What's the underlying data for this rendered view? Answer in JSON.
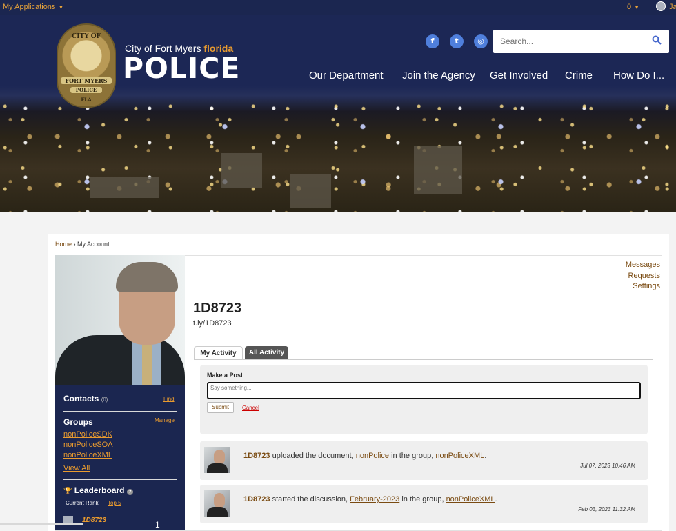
{
  "topbar": {
    "apps_label": "My Applications",
    "notif_count": "0",
    "user_initial": "Ja"
  },
  "brand": {
    "city": "City of Fort Myers",
    "state": "florida",
    "title": "POLICE",
    "badge": {
      "top": "CITY OF",
      "mid": "FORT MYERS",
      "police": "POLICE",
      "state": "FLA"
    }
  },
  "social": [
    {
      "icon": "facebook-icon",
      "glyph": "f"
    },
    {
      "icon": "twitter-icon",
      "glyph": "t"
    },
    {
      "icon": "instagram-icon",
      "glyph": "◎"
    }
  ],
  "search": {
    "placeholder": "Search...",
    "icon": "search-icon"
  },
  "nav": [
    "Our Department",
    "Join the Agency",
    "Get Involved",
    "Crime",
    "How Do I..."
  ],
  "breadcrumb": {
    "home": "Home",
    "sep": "›",
    "current": "My Account"
  },
  "profile": {
    "username": "1D8723",
    "short_link": "t.ly/1D8723"
  },
  "right_links": [
    "Messages",
    "Requests",
    "Settings"
  ],
  "sidebar": {
    "contacts_label": "Contacts",
    "contacts_count": "(0)",
    "find_label": "Find",
    "groups_label": "Groups",
    "manage_label": "Manage",
    "groups": [
      "nonPoliceSDK",
      "nonPoliceSOA",
      "nonPoliceXML"
    ],
    "view_all": "View All",
    "leaderboard_label": "Leaderboard",
    "help": "?",
    "current_rank_label": "Current Rank",
    "top5_label": "Top 5",
    "rank_user": "1D8723",
    "rank_value": "1"
  },
  "tabs": [
    "My Activity",
    "All Activity"
  ],
  "post": {
    "label": "Make a Post",
    "placeholder": "Say something...",
    "submit": "Submit",
    "cancel": "Cancel"
  },
  "feed": [
    {
      "user": "1D8723",
      "action": "uploaded the document,",
      "item": "nonPolice",
      "mid": "in the group,",
      "group": "nonPoliceXML",
      "end": ".",
      "time": "Jul 07, 2023 10:46 AM"
    },
    {
      "user": "1D8723",
      "action": "started the discussion,",
      "item": "February-2023",
      "mid": "in the group,",
      "group": "nonPoliceXML",
      "end": ".",
      "time": "Feb 03, 2023 11:32 AM"
    }
  ],
  "colors": {
    "navy": "#1b2650",
    "orange": "#e99b2f",
    "link_brown": "#7a4b12"
  }
}
